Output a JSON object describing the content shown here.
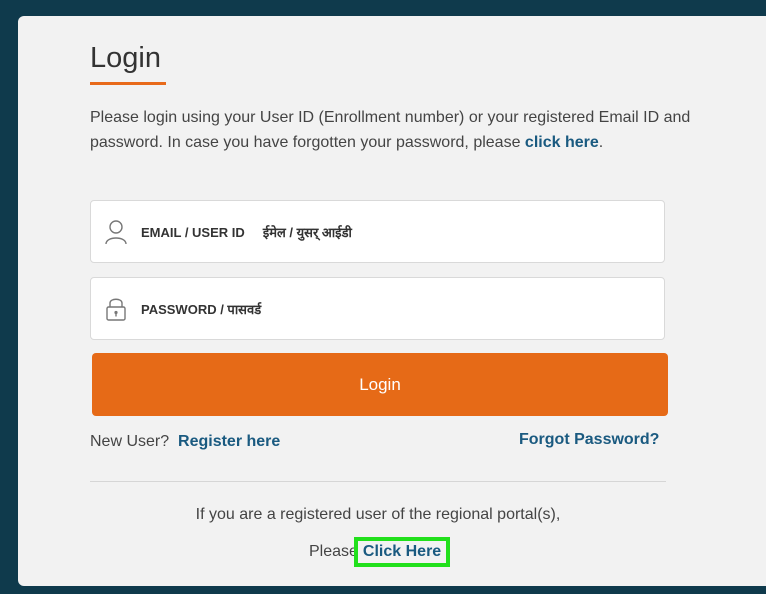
{
  "login": {
    "title": "Login",
    "intro_text": "Please login using your User ID (Enrollment number) or your registered Email ID and password. In case you have forgotten your password, please ",
    "intro_link": "click here",
    "intro_suffix": ".",
    "email_placeholder": "EMAIL / USER ID     ईमेल / युसर् आईडी",
    "password_placeholder": "PASSWORD / पासवर्ड",
    "button_label": "Login"
  },
  "register": {
    "prefix": "New User?",
    "link": "Register here"
  },
  "forgot_password": "Forgot Password?",
  "regional": {
    "line1": "If you are a registered user of the regional portal(s),",
    "prefix": "Please",
    "link": "Click Here"
  },
  "colors": {
    "accent": "#e66a17",
    "link": "#1a5a80",
    "background": "#0f3a4c",
    "highlight": "#22e01c"
  }
}
